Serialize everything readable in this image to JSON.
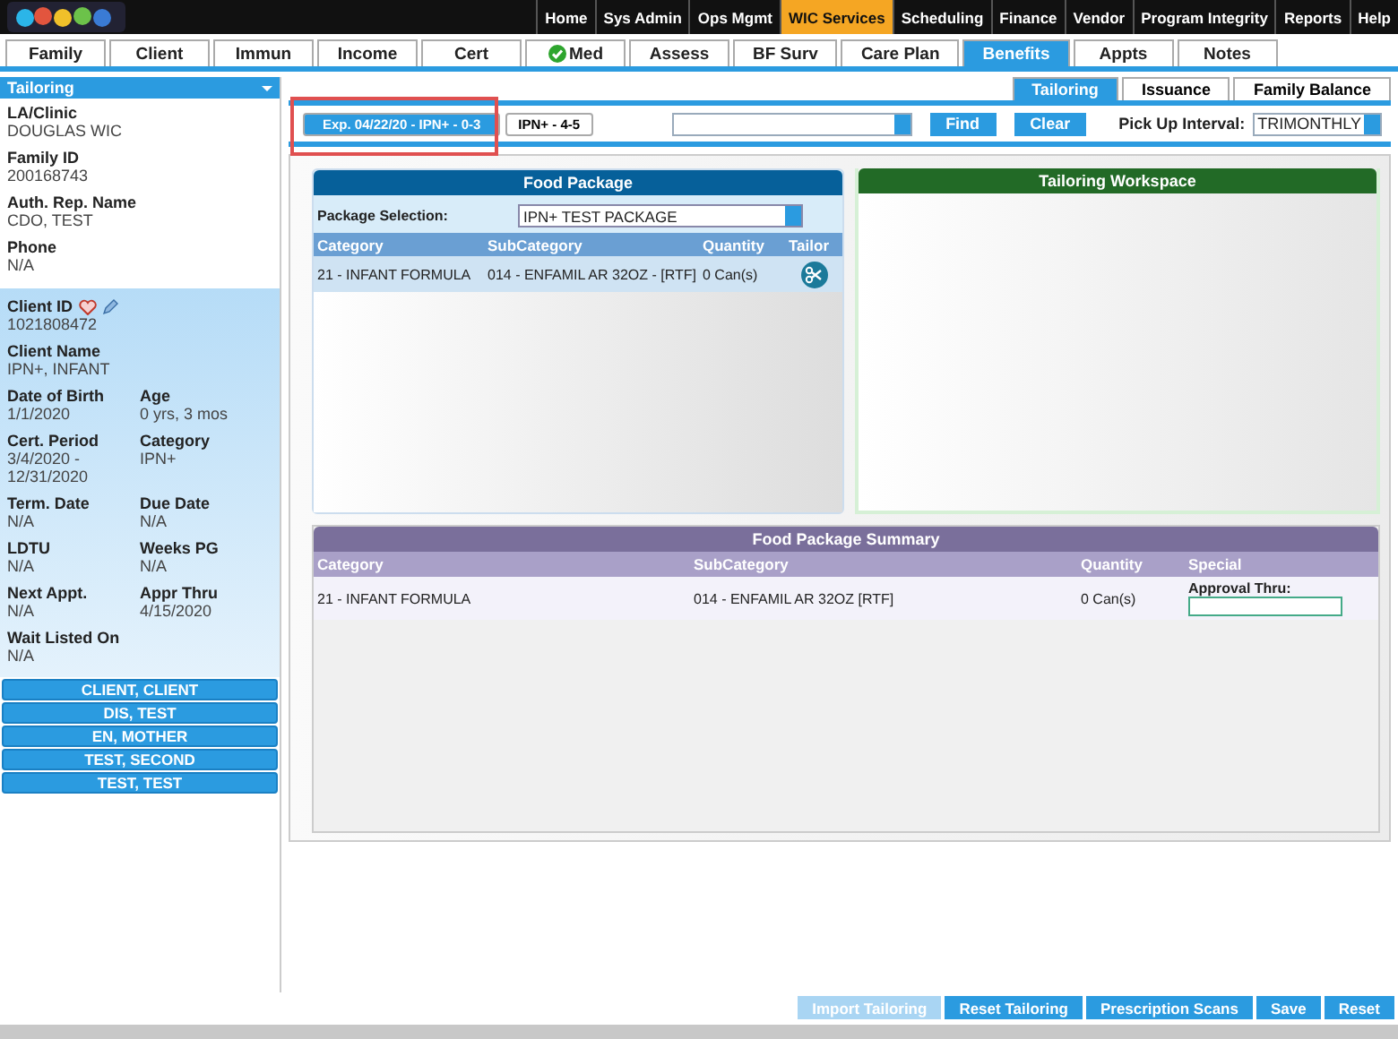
{
  "nav": [
    {
      "label": "Home",
      "selected": false
    },
    {
      "label": "Sys Admin",
      "selected": false
    },
    {
      "label": "Ops Mgmt",
      "selected": false
    },
    {
      "label": "WIC Services",
      "selected": true
    },
    {
      "label": "Scheduling",
      "selected": false
    },
    {
      "label": "Finance",
      "selected": false
    },
    {
      "label": "Vendor",
      "selected": false
    },
    {
      "label": "Program Integrity",
      "selected": false
    },
    {
      "label": "Reports",
      "selected": false
    },
    {
      "label": "Help",
      "selected": false
    }
  ],
  "tabs": [
    {
      "label": "Family",
      "selected": false,
      "verified": false
    },
    {
      "label": "Client",
      "selected": false,
      "verified": false
    },
    {
      "label": "Immun",
      "selected": false,
      "verified": false
    },
    {
      "label": "Income",
      "selected": false,
      "verified": false
    },
    {
      "label": "Cert",
      "selected": false,
      "verified": false
    },
    {
      "label": "Med",
      "selected": false,
      "verified": true
    },
    {
      "label": "Assess",
      "selected": false,
      "verified": false
    },
    {
      "label": "BF Surv",
      "selected": false,
      "verified": false
    },
    {
      "label": "Care Plan",
      "selected": false,
      "verified": false
    },
    {
      "label": "Benefits",
      "selected": true,
      "verified": false
    },
    {
      "label": "Appts",
      "selected": false,
      "verified": false
    },
    {
      "label": "Notes",
      "selected": false,
      "verified": false
    }
  ],
  "sidebar": {
    "dropdown": "Tailoring",
    "family": [
      {
        "label": "LA/Clinic",
        "value": "DOUGLAS WIC"
      },
      {
        "label": "Family ID",
        "value": "200168743"
      },
      {
        "label": "Auth. Rep. Name",
        "value": "CDO, TEST"
      },
      {
        "label": "Phone",
        "value": "N/A"
      }
    ],
    "client_id": {
      "label": "Client ID",
      "value": "1021808472"
    },
    "client_rows": [
      [
        {
          "label": "Client Name",
          "value": "IPN+, INFANT"
        }
      ],
      [
        {
          "label": "Date of Birth",
          "value": "1/1/2020"
        },
        {
          "label": "Age",
          "value": "0 yrs, 3 mos"
        }
      ],
      [
        {
          "label": "Cert. Period",
          "value": "3/4/2020 - 12/31/2020"
        },
        {
          "label": "Category",
          "value": "IPN+"
        }
      ],
      [
        {
          "label": "Term. Date",
          "value": "N/A"
        },
        {
          "label": "Due Date",
          "value": "N/A"
        }
      ],
      [
        {
          "label": "LDTU",
          "value": "N/A"
        },
        {
          "label": "Weeks PG",
          "value": "N/A"
        }
      ],
      [
        {
          "label": "Next Appt.",
          "value": "N/A"
        },
        {
          "label": "Appr Thru",
          "value": "4/15/2020"
        }
      ],
      [
        {
          "label": "Wait Listed On",
          "value": "N/A"
        }
      ]
    ],
    "members": [
      "CLIENT, CLIENT",
      "DIS, TEST",
      "EN, MOTHER",
      "TEST, SECOND",
      "TEST, TEST"
    ]
  },
  "sub_tabs": [
    {
      "label": "Tailoring",
      "selected": true
    },
    {
      "label": "Issuance",
      "selected": false
    },
    {
      "label": "Family Balance",
      "selected": false
    }
  ],
  "toolbar": {
    "packages": [
      {
        "label": "Exp. 04/22/20 - IPN+ - 0-3",
        "selected": true
      },
      {
        "label": "IPN+ - 4-5",
        "selected": false
      }
    ],
    "find": "Find",
    "clear": "Clear",
    "interval_label": "Pick Up Interval:",
    "interval": "TRIMONTHLY"
  },
  "food_package": {
    "title": "Food Package",
    "selection_label": "Package Selection:",
    "selection": "IPN+ TEST PACKAGE",
    "columns": [
      "Category",
      "SubCategory",
      "Quantity",
      "Tailor"
    ],
    "rows": [
      {
        "category": "21 - INFANT FORMULA",
        "subcategory": "014 - ENFAMIL AR 32OZ - [RTF]",
        "quantity": "0 Can(s)"
      }
    ]
  },
  "workspace": {
    "title": "Tailoring Workspace"
  },
  "summary": {
    "title": "Food Package Summary",
    "columns": [
      "Category",
      "SubCategory",
      "Quantity",
      "Special"
    ],
    "rows": [
      {
        "category": "21 - INFANT FORMULA",
        "subcategory": "014 - ENFAMIL AR 32OZ [RTF]",
        "quantity": "0 Can(s)",
        "approval_label": "Approval Thru:"
      }
    ]
  },
  "footer": [
    {
      "label": "Import Tailoring",
      "disabled": true
    },
    {
      "label": "Reset Tailoring",
      "disabled": false
    },
    {
      "label": "Prescription Scans",
      "disabled": false
    },
    {
      "label": "Save",
      "disabled": false
    },
    {
      "label": "Reset",
      "disabled": false
    }
  ]
}
